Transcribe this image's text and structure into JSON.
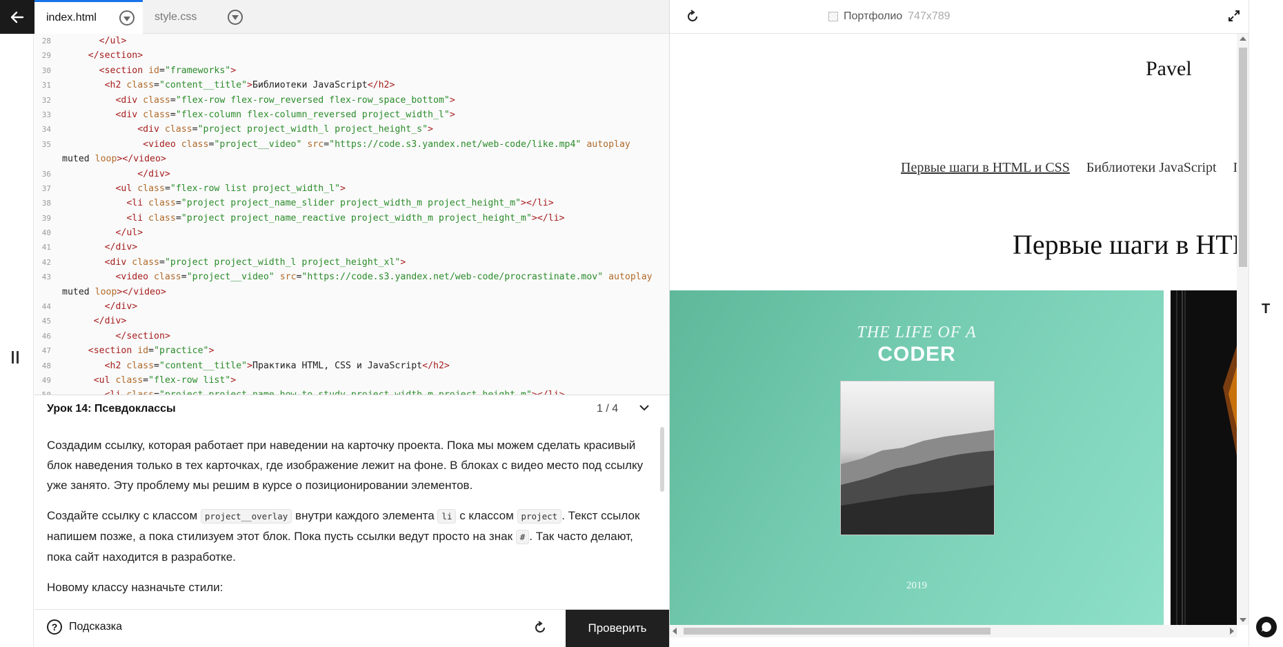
{
  "editor": {
    "tabs": [
      {
        "label": "index.html",
        "active": true
      },
      {
        "label": "style.css",
        "active": false
      }
    ],
    "code_lines": [
      {
        "n": "28",
        "html": "      </ul>"
      },
      {
        "n": "29",
        "html": "    </section>"
      },
      {
        "n": "30",
        "html": "      <section id=\"frameworks\">"
      },
      {
        "n": "31",
        "html": "       <h2 class=\"content__title\">Библиотеки JavaScript</h2>"
      },
      {
        "n": "32",
        "html": "         <div class=\"flex-row flex-row_reversed flex-row_space_bottom\">"
      },
      {
        "n": "33",
        "html": "         <div class=\"flex-column flex-column_reversed project_width_l\">"
      },
      {
        "n": "34",
        "html": "             <div class=\"project project_width_l project_height_s\">"
      },
      {
        "n": "35",
        "html": "              <video class=\"project__video\" src=\"https://code.s3.yandex.net/web-code/like.mp4\" autoplay"
      },
      {
        "n": "",
        "html": "muted loop></video>"
      },
      {
        "n": "36",
        "html": "             </div>"
      },
      {
        "n": "37",
        "html": "         <ul class=\"flex-row list project_width_l\">"
      },
      {
        "n": "38",
        "html": "           <li class=\"project project_name_slider project_width_m project_height_m\"></li>"
      },
      {
        "n": "39",
        "html": "           <li class=\"project project_name_reactive project_width_m project_height_m\"></li>"
      },
      {
        "n": "40",
        "html": "         </ul>"
      },
      {
        "n": "41",
        "html": "       </div>"
      },
      {
        "n": "42",
        "html": "       <div class=\"project project_width_l project_height_xl\">"
      },
      {
        "n": "43",
        "html": "         <video class=\"project__video\" src=\"https://code.s3.yandex.net/web-code/procrastinate.mov\" autoplay"
      },
      {
        "n": "",
        "html": "muted loop></video>"
      },
      {
        "n": "44",
        "html": "       </div>"
      },
      {
        "n": "45",
        "html": "     </div>"
      },
      {
        "n": "46",
        "html": "         </section>"
      },
      {
        "n": "47",
        "html": "    <section id=\"practice\">"
      },
      {
        "n": "48",
        "html": "       <h2 class=\"content__title\">Практика HTML, CSS и JavaScript</h2>"
      },
      {
        "n": "49",
        "html": "     <ul class=\"flex-row list\">"
      },
      {
        "n": "50",
        "html": "       <li class=\"project project_name_how-to-study project_width_m project_height_m\"></li>"
      }
    ]
  },
  "lesson": {
    "title": "Урок 14: Псевдоклассы",
    "page": "1 / 4",
    "p1": "Создадим ссылку, которая работает при наведении на карточку проекта. Пока мы можем сделать красивый блок наведения только в тех карточках, где изображение лежит на фоне. В блоках с видео место под ссылку уже занято. Эту проблему мы решим в курсе о позиционировании элементов.",
    "p2_a": "Создайте ссылку с классом ",
    "p2_code1": "project__overlay",
    "p2_b": " внутри каждого элемента ",
    "p2_code2": "li",
    "p2_c": " с классом ",
    "p2_code3": "project",
    "p2_d": ". Текст ссылок напишем позже, а пока стилизуем этот блок. Пока пусть ссылки ведут просто на знак ",
    "p2_code4": "#",
    "p2_e": ". Так часто делают, пока сайт находится в разработке.",
    "p3": "Новому классу назначьте стили:"
  },
  "footer": {
    "hint_label": "Подсказка",
    "check_label": "Проверить"
  },
  "preview": {
    "title": "Портфолио",
    "size": "747x789",
    "site": {
      "name": "Pavel",
      "nav": [
        "Первые шаги в HTML и CSS",
        "Библиотеки JavaScript",
        "Пр"
      ],
      "heading": "Первые шаги в HTM",
      "card": {
        "tagline": "THE LIFE OF A",
        "title": "CODER",
        "year": "2019"
      }
    }
  },
  "right_rail": {
    "tool_label": "T"
  },
  "colors": {
    "accent": "#1a73e8",
    "dark": "#202020",
    "card_green": "#74cbb0"
  },
  "icons": [
    "back-arrow-icon",
    "pause-icon",
    "chevron-down-icon",
    "help-icon",
    "reset-icon",
    "refresh-icon",
    "page-icon",
    "expand-icon",
    "chat-icon"
  ]
}
